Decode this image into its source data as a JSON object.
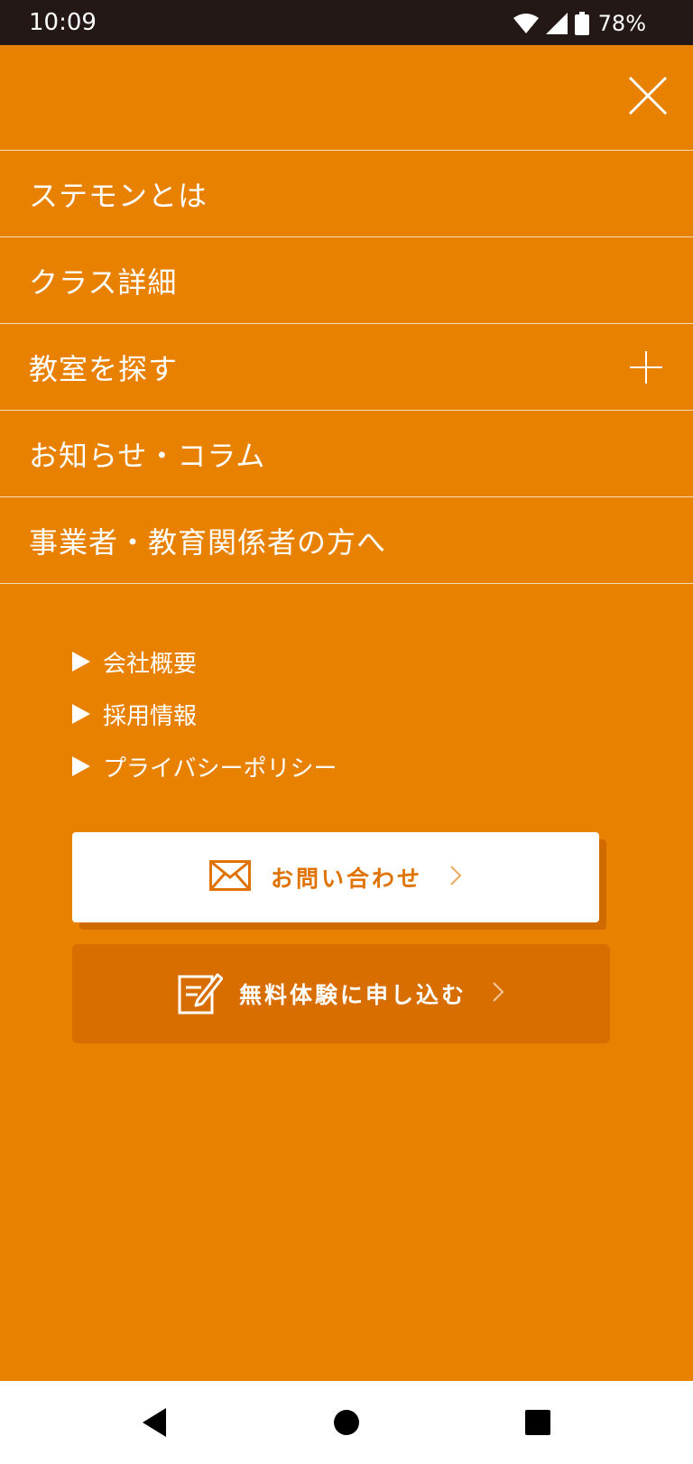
{
  "status_bar": {
    "time": "10:09",
    "battery": "78%",
    "icons": [
      "wifi-icon",
      "signal-icon",
      "battery-icon"
    ]
  },
  "menu": {
    "close_icon": "close-icon",
    "items": [
      {
        "label": "ステモンとは",
        "expandable": false
      },
      {
        "label": "クラス詳細",
        "expandable": false
      },
      {
        "label": "教室を探す",
        "expandable": true
      },
      {
        "label": "お知らせ・コラム",
        "expandable": false
      },
      {
        "label": "事業者・教育関係者の方へ",
        "expandable": false
      }
    ],
    "sub_links": [
      {
        "label": "会社概要"
      },
      {
        "label": "採用情報"
      },
      {
        "label": "プライバシーポリシー"
      }
    ]
  },
  "cta": {
    "contact_label": "お問い合わせ",
    "trial_label": "無料体験に申し込む"
  },
  "colors": {
    "background": "#e98100",
    "status_bar": "#231815",
    "trial_button": "#d86d00",
    "contact_text": "#e07200"
  },
  "system_nav": {
    "icons": [
      "back-icon",
      "home-icon",
      "recents-icon"
    ]
  }
}
